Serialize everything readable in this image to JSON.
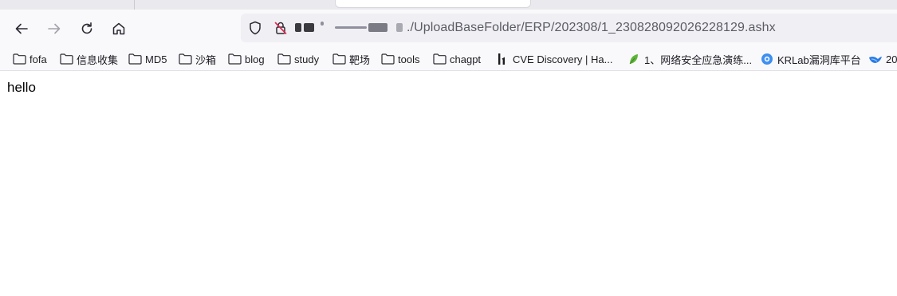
{
  "url": "./UploadBaseFolder/ERP/202308/1_230828092026228129.ashx",
  "bookmarks": [
    {
      "label": "fofa",
      "icon": "folder-icon"
    },
    {
      "label": "信息收集",
      "icon": "folder-icon"
    },
    {
      "label": "MD5",
      "icon": "folder-icon"
    },
    {
      "label": "沙箱",
      "icon": "folder-icon"
    },
    {
      "label": "blog",
      "icon": "folder-icon"
    },
    {
      "label": "study",
      "icon": "folder-icon"
    },
    {
      "label": "靶场",
      "icon": "folder-icon"
    },
    {
      "label": "tools",
      "icon": "folder-icon"
    },
    {
      "label": "chagpt",
      "icon": "folder-icon"
    },
    {
      "label": "CVE Discovery | Ha...",
      "icon": "hackerone-icon"
    },
    {
      "label": "1、网络安全应急演练...",
      "icon": "leaf-icon"
    },
    {
      "label": "KRLab漏洞库平台",
      "icon": "krlab-icon"
    },
    {
      "label": "20",
      "icon": "bird-icon"
    }
  ],
  "page": {
    "body_text": "hello"
  },
  "colors": {
    "toolbar": "#f9f9fb",
    "urlbar": "#f0f0f4",
    "text": "#1c1b22"
  }
}
